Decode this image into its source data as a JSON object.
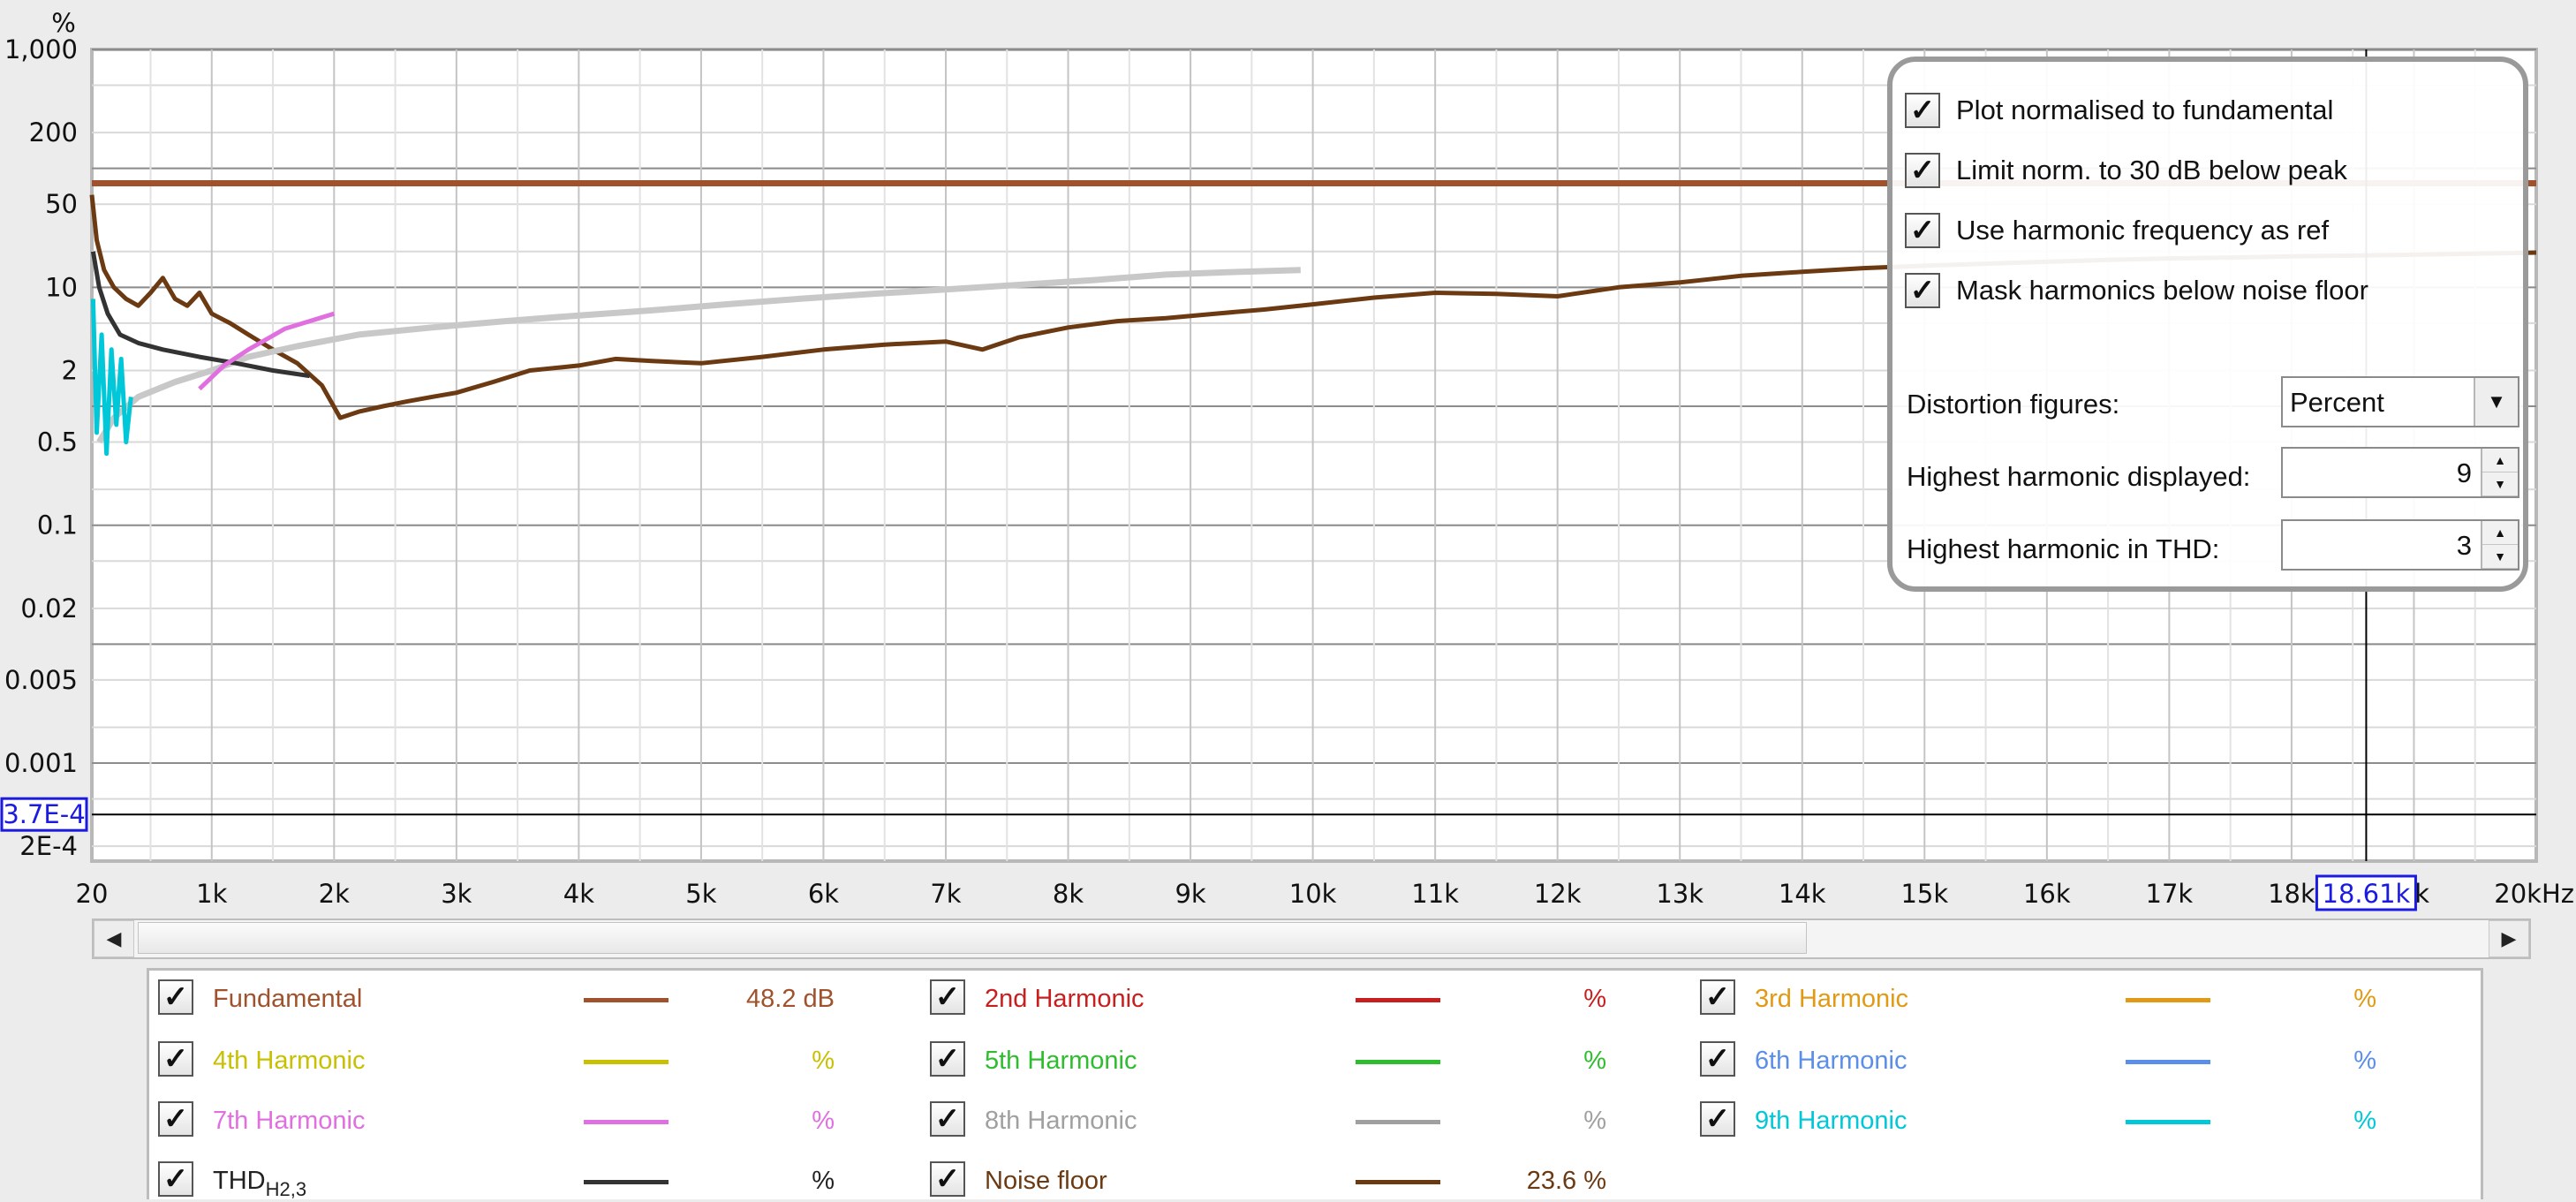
{
  "chart_data": {
    "type": "line",
    "y_unit": "%",
    "y_scale": "log",
    "y_ticks": [
      "1,000",
      "200",
      "50",
      "10",
      "2",
      "0.5",
      "0.1",
      "0.02",
      "0.005",
      "0.001",
      "2E-4"
    ],
    "x_ticks": [
      "20",
      "1k",
      "2k",
      "3k",
      "4k",
      "5k",
      "6k",
      "7k",
      "8k",
      "9k",
      "10k",
      "11k",
      "12k",
      "13k",
      "14k",
      "15k",
      "16k",
      "17k",
      "18k",
      "9k",
      "20kHz"
    ],
    "x_unit": "Hz",
    "xlim": [
      20,
      20000
    ],
    "ylim": [
      0.00015,
      1000
    ],
    "grid": true,
    "cursor": {
      "x_label": "18.61k",
      "y_label": "3.7E-4",
      "x_value": 18610,
      "y_value": 0.00037
    },
    "series": [
      {
        "name": "Fundamental",
        "color": "#a0522d",
        "x": [
          20,
          20000
        ],
        "y": [
          75,
          75
        ]
      },
      {
        "name": "Noise floor",
        "color": "#6b3a12",
        "x": [
          20,
          60,
          120,
          200,
          300,
          400,
          500,
          600,
          700,
          800,
          900,
          1000,
          1150,
          1300,
          1500,
          1700,
          1900,
          2050,
          2200,
          2400,
          2600,
          2800,
          3000,
          3300,
          3600,
          4000,
          4300,
          4600,
          5000,
          5500,
          6000,
          6500,
          7000,
          7300,
          7600,
          8000,
          8400,
          8800,
          9200,
          9600,
          10000,
          10500,
          11000,
          11500,
          12000,
          12500,
          13000,
          13500,
          14000,
          14500,
          15000,
          15500,
          16000,
          16500,
          17000,
          17500,
          18000,
          18500,
          19000,
          19500,
          20000
        ],
        "y": [
          60,
          25,
          14,
          10,
          8,
          7,
          9,
          12,
          8,
          7,
          9,
          6,
          5,
          4,
          3,
          2.3,
          1.5,
          0.8,
          0.9,
          1.0,
          1.1,
          1.2,
          1.3,
          1.6,
          2.0,
          2.2,
          2.5,
          2.4,
          2.3,
          2.6,
          3.0,
          3.3,
          3.5,
          3.0,
          3.8,
          4.6,
          5.2,
          5.5,
          6.0,
          6.5,
          7.2,
          8.2,
          9.0,
          8.8,
          8.4,
          10.0,
          11.0,
          12.5,
          13.5,
          14.5,
          15.2,
          15.8,
          16.4,
          17.0,
          17.5,
          17.8,
          18.2,
          18.5,
          18.8,
          19.2,
          19.6
        ]
      },
      {
        "name": "8th Harmonic",
        "color": "#c8c8c8",
        "x": [
          80,
          200,
          400,
          700,
          1000,
          1300,
          1700,
          2200,
          2800,
          3400,
          4000,
          4600,
          5200,
          5800,
          6400,
          7000,
          7600,
          8200,
          8800,
          9300,
          9900
        ],
        "y": [
          0.5,
          0.8,
          1.2,
          1.6,
          2.0,
          2.6,
          3.2,
          4.0,
          4.6,
          5.2,
          5.8,
          6.4,
          7.2,
          8.0,
          8.8,
          9.6,
          10.5,
          11.5,
          12.8,
          13.4,
          14.0
        ]
      },
      {
        "name": "THD H2,3",
        "color": "#333333",
        "x": [
          30,
          80,
          150,
          250,
          400,
          600,
          900,
          1200,
          1500,
          1800
        ],
        "y": [
          20,
          10,
          6,
          4,
          3.4,
          3.0,
          2.6,
          2.3,
          2.0,
          1.8
        ]
      },
      {
        "name": "9th Harmonic",
        "color": "#00c8d8",
        "x": [
          30,
          60,
          100,
          140,
          180,
          220,
          260,
          300,
          340
        ],
        "y": [
          8,
          0.6,
          4,
          0.4,
          3,
          0.7,
          2.5,
          0.5,
          1.2
        ]
      },
      {
        "name": "7th Harmonic",
        "color": "#e070e0",
        "x": [
          900,
          1100,
          1300,
          1600,
          2000
        ],
        "y": [
          1.4,
          2.2,
          3.0,
          4.5,
          6.0
        ]
      }
    ]
  },
  "panel": {
    "options": [
      {
        "label": "Plot normalised to fundamental",
        "checked": "✓"
      },
      {
        "label": "Limit norm. to 30 dB below peak",
        "checked": "✓"
      },
      {
        "label": "Use harmonic frequency as ref",
        "checked": "✓"
      },
      {
        "label": "Mask harmonics below noise floor",
        "checked": "✓"
      }
    ],
    "distortion_label": "Distortion figures:",
    "distortion_value": "Percent",
    "highest_displayed_label": "Highest harmonic displayed:",
    "highest_displayed_value": "9",
    "highest_thd_label": "Highest harmonic in THD:",
    "highest_thd_value": "3"
  },
  "legend": [
    {
      "name": "Fundamental",
      "color": "#a0522d",
      "value": "48.2 dB",
      "value_color": "#a0522d",
      "checked": "✓"
    },
    {
      "name": "2nd Harmonic",
      "color": "#c81e1e",
      "value": "%",
      "value_color": "#c81e1e",
      "checked": "✓"
    },
    {
      "name": "3rd Harmonic",
      "color": "#e09a14",
      "value": "%",
      "value_color": "#e09a14",
      "checked": "✓"
    },
    {
      "name": "4th Harmonic",
      "color": "#c8c000",
      "value": "%",
      "value_color": "#c8c000",
      "checked": "✓"
    },
    {
      "name": "5th Harmonic",
      "color": "#2ebd2e",
      "value": "%",
      "value_color": "#2ebd2e",
      "checked": "✓"
    },
    {
      "name": "6th Harmonic",
      "color": "#5b8ee8",
      "value": "%",
      "value_color": "#5b8ee8",
      "checked": "✓"
    },
    {
      "name": "7th Harmonic",
      "color": "#e070e0",
      "value": "%",
      "value_color": "#e070e0",
      "checked": "✓"
    },
    {
      "name": "8th Harmonic",
      "color": "#a0a0a0",
      "value": "%",
      "value_color": "#a0a0a0",
      "checked": "✓"
    },
    {
      "name": "9th Harmonic",
      "color": "#00c8d8",
      "value": "%",
      "value_color": "#00c8d8",
      "checked": "✓"
    },
    {
      "name": "THD",
      "subscript": "H2,3",
      "color": "#333333",
      "value": "%",
      "value_color": "#222222",
      "checked": "✓"
    },
    {
      "name": "Noise floor",
      "color": "#6b3a12",
      "value": "23.6 %",
      "value_color": "#6b3a12",
      "checked": "✓"
    }
  ],
  "scroll": {
    "left_icon": "◀",
    "right_icon": "▶"
  },
  "icons": {
    "dropdown": "▼",
    "spin_up": "▲",
    "spin_down": "▼"
  }
}
